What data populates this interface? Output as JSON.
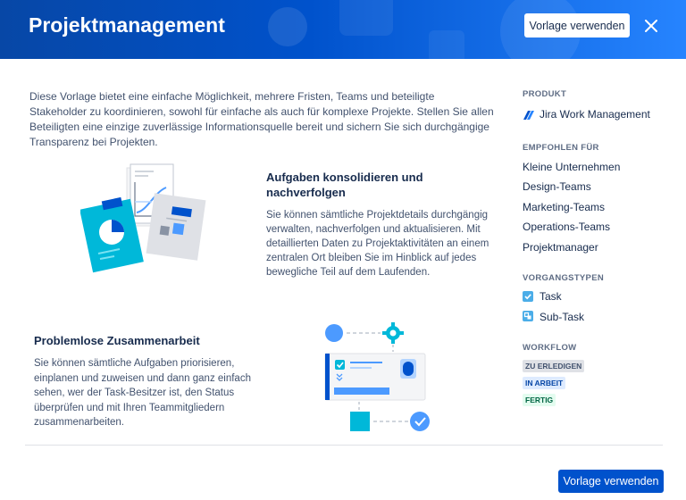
{
  "header": {
    "title": "Projektmanagement",
    "use_template_label": "Vorlage verwenden",
    "close_icon": "close-icon"
  },
  "description": "Diese Vorlage bietet eine einfache Möglichkeit, mehrere Fristen, Teams und beteiligte Stakeholder zu koordinieren, sowohl für einfache als auch für komplexe Projekte. Stellen Sie allen Beteiligten eine einzige zuverlässige Informationsquelle bereit und sichern Sie sich durchgängige Transparenz bei Projekten.",
  "features": [
    {
      "title": "Aufgaben konsolidieren und nachverfolgen",
      "text": "Sie können sämtliche Projektdetails durchgängig verwalten, nachverfolgen und aktualisieren. Mit detaillierten Daten zu Projektaktivitäten an einem zentralen Ort bleiben Sie im Hinblick auf jedes bewegliche Teil auf dem Laufenden."
    },
    {
      "title": "Problemlose Zusammenarbeit",
      "text": "Sie können sämtliche Aufgaben priorisieren, einplanen und zuweisen und dann ganz einfach sehen, wer der Task-Besitzer ist, den Status überprüfen und mit Ihren Teammitgliedern zusammenarbeiten."
    }
  ],
  "sidebar": {
    "product": {
      "title": "PRODUKT",
      "name": "Jira Work Management",
      "icon": "jira-work-management-icon"
    },
    "recommended": {
      "title": "EMPFOHLEN FÜR",
      "items": [
        "Kleine Unternehmen",
        "Design-Teams",
        "Marketing-Teams",
        "Operations-Teams",
        "Projektmanager"
      ]
    },
    "issue_types": {
      "title": "VORGANGSTYPEN",
      "items": [
        {
          "label": "Task",
          "icon": "task-checkbox-icon"
        },
        {
          "label": "Sub-Task",
          "icon": "subtask-icon"
        }
      ]
    },
    "workflow": {
      "title": "WORKFLOW",
      "statuses": [
        {
          "label": "ZU ERLEDIGEN",
          "bg": "#dfe1e6",
          "fg": "#42526e"
        },
        {
          "label": "IN ARBEIT",
          "bg": "#deebff",
          "fg": "#0747a6"
        },
        {
          "label": "FERTIG",
          "bg": "#e3fcef",
          "fg": "#006644"
        }
      ]
    }
  },
  "footer": {
    "use_template_label": "Vorlage verwenden"
  },
  "colors": {
    "header_start": "#0747a6",
    "header_end": "#2684ff",
    "primary": "#0052cc",
    "teal": "#00b8d9"
  }
}
